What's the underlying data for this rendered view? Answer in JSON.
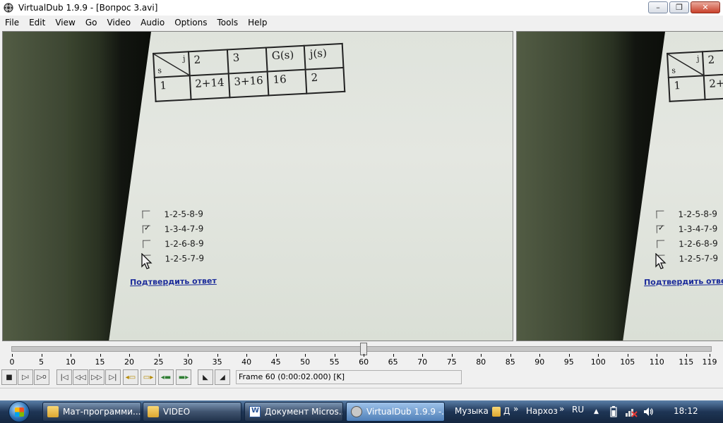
{
  "window": {
    "title": "VirtualDub 1.9.9 - [Вопрос 3.avi]",
    "controls": {
      "minimize": "–",
      "maximize": "❐",
      "close": "✕"
    }
  },
  "menu": [
    "File",
    "Edit",
    "View",
    "Go",
    "Video",
    "Audio",
    "Options",
    "Tools",
    "Help"
  ],
  "video_frame": {
    "table": {
      "corner_top": "j",
      "corner_bottom": "s",
      "headers": [
        "2",
        "3",
        "G(s)",
        "j(s)"
      ],
      "row": [
        "1",
        "2+14",
        "3+16",
        "16",
        "2"
      ]
    },
    "options": [
      {
        "label": "1-2-5-8-9",
        "checked": false
      },
      {
        "label": "1-3-4-7-9",
        "checked": true
      },
      {
        "label": "1-2-6-8-9",
        "checked": false
      },
      {
        "label": "1-2-5-7-9",
        "checked": false
      }
    ],
    "confirm_link": "Подтвердить ответ"
  },
  "timeline": {
    "ticks": [
      "0",
      "5",
      "10",
      "15",
      "20",
      "25",
      "30",
      "35",
      "40",
      "45",
      "50",
      "55",
      "60",
      "65",
      "70",
      "75",
      "80",
      "85",
      "90",
      "95",
      "100",
      "105",
      "110",
      "115",
      "119"
    ],
    "current_frame": 60,
    "max_frame": 119
  },
  "toolbar": {
    "frame_status": "Frame 60 (0:00:02.000) [K]"
  },
  "taskbar": {
    "items": [
      {
        "label": "Мат-программи...",
        "icon": "folder-icon",
        "active": false
      },
      {
        "label": "VIDEO",
        "icon": "folder-icon",
        "active": false
      },
      {
        "label": "Документ Micros...",
        "icon": "word-doc-icon",
        "active": false
      },
      {
        "label": "VirtualDub 1.9.9 -...",
        "icon": "virtualdub-icon",
        "active": true
      }
    ],
    "tray": {
      "music": "Музыка",
      "music_folder": "Д",
      "chev1": "»",
      "narhoz": "Нархоз",
      "chev2": "»",
      "lang": "RU",
      "up": "▲",
      "clock": "18:12"
    }
  }
}
